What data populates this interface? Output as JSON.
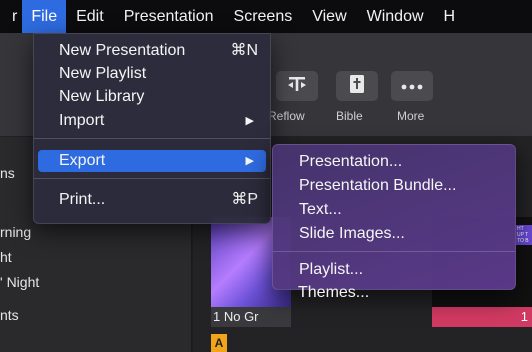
{
  "menubar": {
    "app_partial": "r",
    "items": [
      "File",
      "Edit",
      "Presentation",
      "Screens",
      "View",
      "Window",
      "H"
    ]
  },
  "toolbar": {
    "buttons": [
      {
        "label": "Reflow",
        "icon": "reflow-icon"
      },
      {
        "label": "Bible",
        "icon": "bible-icon"
      },
      {
        "label": "More",
        "icon": "more-icon"
      }
    ]
  },
  "sidebar": {
    "items": [
      "ns",
      "rning",
      "ht",
      "' Night",
      "nts"
    ]
  },
  "content": {
    "slide1_caption": "1 No Gr",
    "slide1_label": "A",
    "slide2_caption": "1",
    "slide2_text": "HT UP T TO B"
  },
  "file_menu": {
    "new_presentation": "New Presentation",
    "new_presentation_shortcut": "⌘N",
    "new_playlist": "New Playlist",
    "new_library": "New Library",
    "import": "Import",
    "export": "Export",
    "print": "Print...",
    "print_shortcut": "⌘P"
  },
  "export_menu": {
    "items": [
      "Presentation...",
      "Presentation Bundle...",
      "Text...",
      "Slide Images...",
      "Playlist...",
      "Themes..."
    ]
  },
  "colors": {
    "menu_highlight": "#2f6be0",
    "slide_label": "#f2a51a",
    "slide_accent": "#d13a62"
  }
}
